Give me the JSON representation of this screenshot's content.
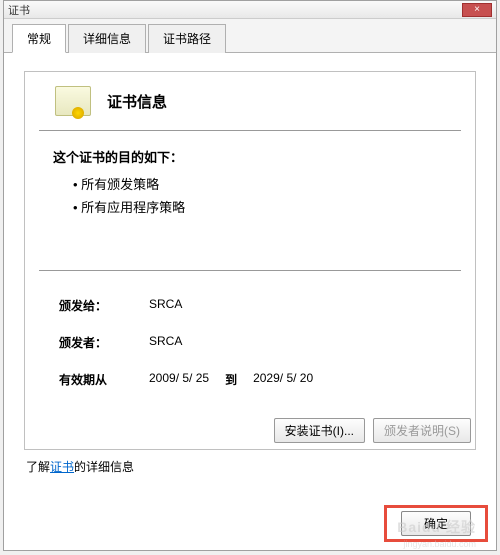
{
  "window": {
    "title": "证书",
    "close": "×"
  },
  "tabs": {
    "general": "常规",
    "details": "详细信息",
    "path": "证书路径"
  },
  "cert": {
    "info_title": "证书信息",
    "purpose_heading": "这个证书的目的如下：",
    "purposes": {
      "p0": "所有颁发策略",
      "p1": "所有应用程序策略"
    },
    "issued_to_label": "颁发给：",
    "issued_to": "SRCA",
    "issued_by_label": "颁发者：",
    "issued_by": "SRCA",
    "valid_from_label": "有效期从",
    "valid_from": "2009/  5/  25",
    "valid_to_label": "到",
    "valid_to": "2029/  5/  20"
  },
  "buttons": {
    "install": "安装证书(I)...",
    "issuer_statement": "颁发者说明(S)",
    "ok": "确定"
  },
  "learn_more": {
    "prefix": "了解",
    "link": "证书",
    "suffix": "的详细信息"
  },
  "watermark": {
    "main": "Baidu 经验",
    "sub": "jingyan.baidu.com"
  }
}
